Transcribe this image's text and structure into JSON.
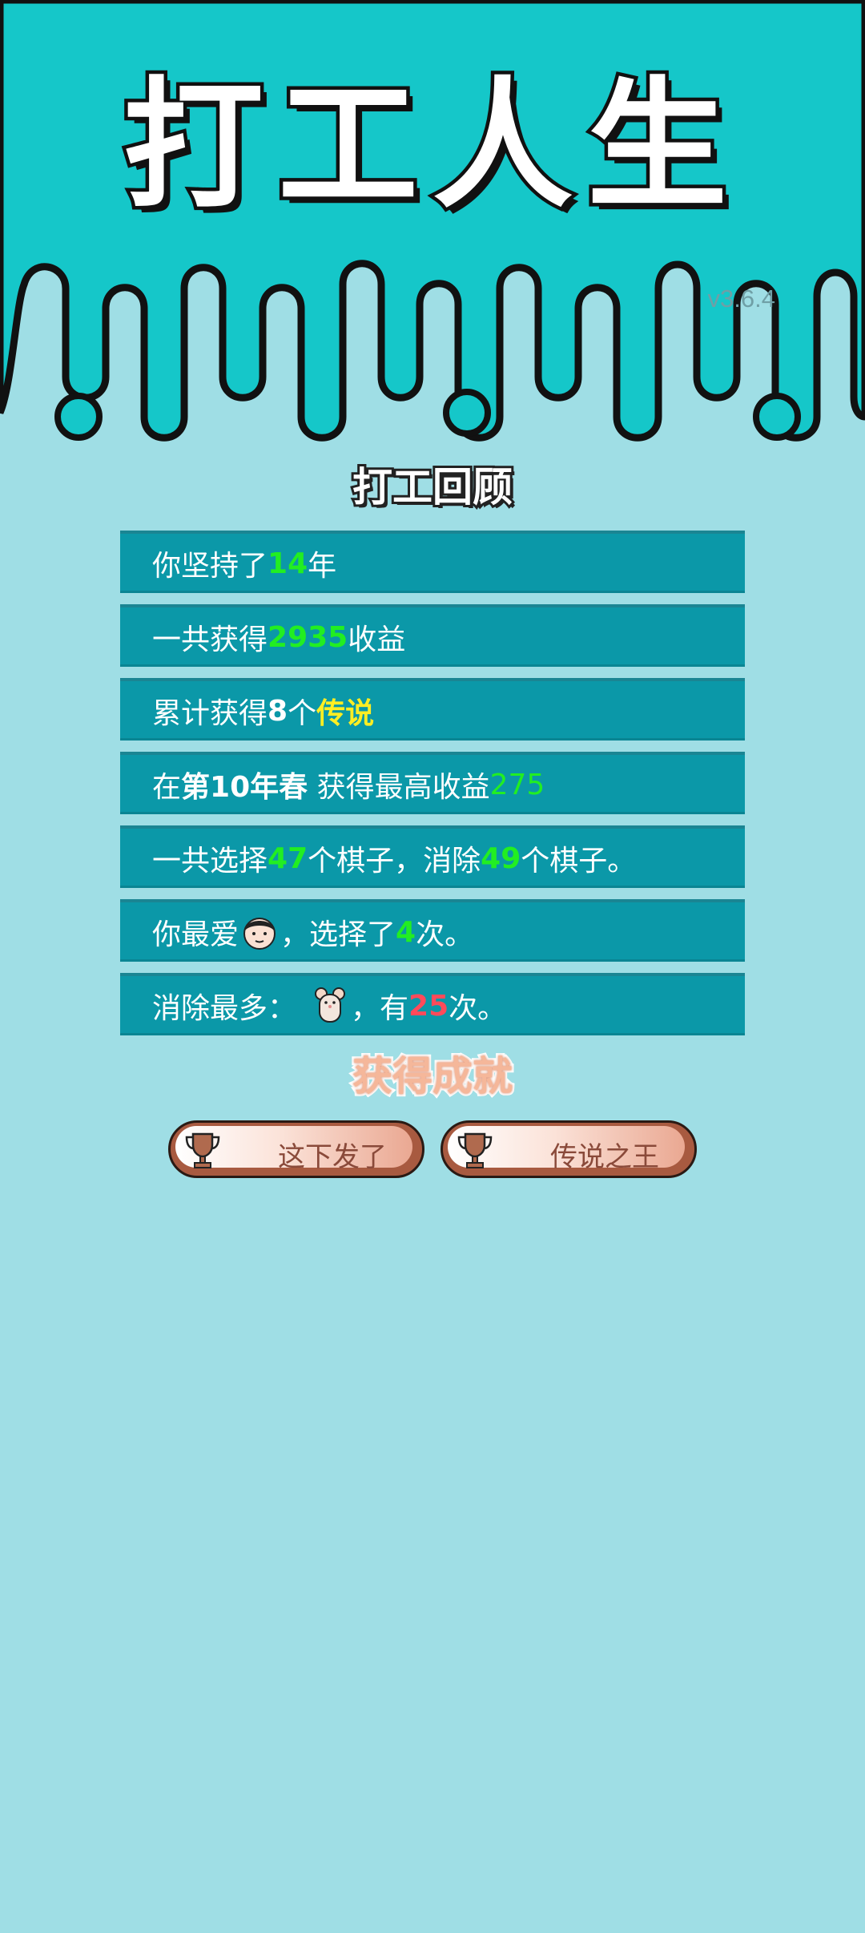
{
  "header": {
    "title": "打工人生",
    "version": "v3.6.4"
  },
  "review": {
    "title": "打工回顾",
    "rows": [
      {
        "parts": [
          "你坚持了",
          "14",
          "年"
        ]
      },
      {
        "parts": [
          "一共获得",
          "2935",
          "收益"
        ]
      },
      {
        "parts": [
          "累计获得",
          "8",
          "个",
          "传说"
        ]
      },
      {
        "parts": [
          "在 ",
          "第10年春",
          " 获得最高收益",
          "275"
        ]
      },
      {
        "parts": [
          "一共选择",
          "47",
          "个棋子，消除",
          "49",
          "个棋子。"
        ]
      },
      {
        "parts": [
          "你最爱",
          "，选择了",
          "4",
          "次。"
        ],
        "icon": "boy-face-icon"
      },
      {
        "parts": [
          "消除最多：",
          "，有",
          "25",
          "次。"
        ],
        "icon": "mouse-icon"
      }
    ]
  },
  "achievements": {
    "title": "获得成就",
    "items": [
      {
        "label": "这下发了",
        "icon": "trophy-icon"
      },
      {
        "label": "传说之王",
        "icon": "trophy-icon"
      }
    ]
  },
  "colors": {
    "background": "#9fdee5",
    "header": "#15c7c9",
    "row": "#0b98a8",
    "highlight_green": "#22ee22",
    "highlight_yellow": "#ffee22",
    "highlight_red": "#ff4a5a",
    "achievement": "#f5b79a"
  }
}
